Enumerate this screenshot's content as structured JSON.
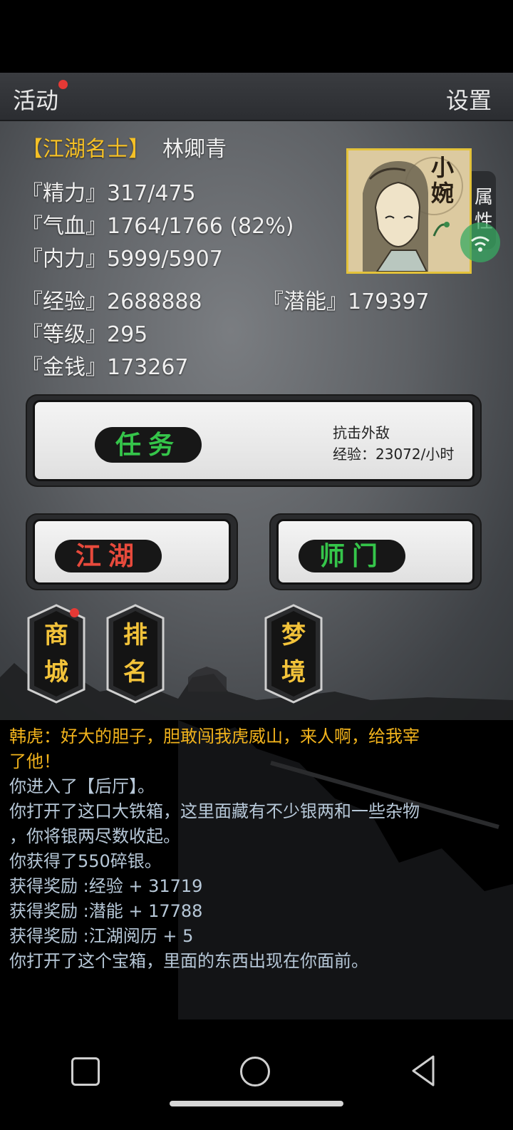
{
  "topbar": {
    "activity_label": "活动",
    "settings_label": "设置"
  },
  "profile": {
    "title": "【江湖名士】",
    "name": "林卿青",
    "stats": [
      {
        "label": "『精力』",
        "value": "317/475"
      },
      {
        "label": "『气血』",
        "value": "1764/1766 (82%)"
      },
      {
        "label": "『内力』",
        "value": "5999/5907"
      }
    ],
    "exp": {
      "label": "『经验』",
      "value": "2688888"
    },
    "potential": {
      "label": "『潜能』",
      "value": "179397"
    },
    "level": {
      "label": "『等级』",
      "value": "295"
    },
    "money": {
      "label": "『金钱』",
      "value": "173267"
    },
    "portrait_text": "小婉",
    "attr_tab": "属性"
  },
  "mission": {
    "label": "任务",
    "name": "抗击外敌",
    "rate": "经验：23072/小时"
  },
  "buttons": {
    "jianghu": "江湖",
    "shimen": "师门"
  },
  "tags": {
    "shop": "商城",
    "rank": "排名",
    "dream": "梦境"
  },
  "log": [
    {
      "text": "韩虎：好大的胆子，胆敢闯我虎威山，来人啊，给我宰",
      "color": "#f2b31c"
    },
    {
      "text": "了他！",
      "color": "#f2b31c"
    },
    {
      "text": "你进入了【后厅】。",
      "color": "#b7c8d8"
    },
    {
      "text": "你打开了这口大铁箱，这里面藏有不少银两和一些杂物",
      "color": "#b7c8d8"
    },
    {
      "text": "，你将银两尽数收起。",
      "color": "#b7c8d8"
    },
    {
      "text": "你获得了550碎银。",
      "color": "#b7c8d8"
    },
    {
      "text": "获得奖励 :经验 + 31719",
      "color": "#b7c8d8"
    },
    {
      "text": "获得奖励 :潜能 + 17788",
      "color": "#b7c8d8"
    },
    {
      "text": "获得奖励 :江湖阅历 + 5",
      "color": "#b7c8d8"
    },
    {
      "text": "你打开了这个宝箱，里面的东西出现在你面前。",
      "color": "#b7c8d8"
    }
  ]
}
